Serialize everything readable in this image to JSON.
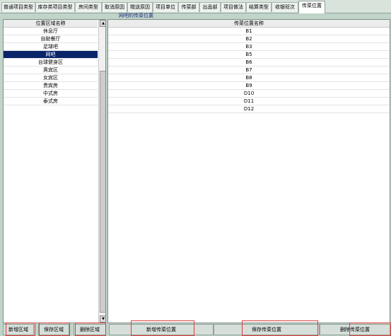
{
  "tabs": [
    {
      "label": "普通项目类型"
    },
    {
      "label": "库存类项目类型"
    },
    {
      "label": "房间类型"
    },
    {
      "label": "取消原因"
    },
    {
      "label": "赠送原因"
    },
    {
      "label": "项目单位"
    },
    {
      "label": "传菜部"
    },
    {
      "label": "出品部"
    },
    {
      "label": "项目做法"
    },
    {
      "label": "结算类型"
    },
    {
      "label": "收银班次"
    },
    {
      "label": "传菜位置"
    }
  ],
  "left_panel": {
    "column_header": "位置区域名称",
    "items": [
      {
        "label": "休息厅"
      },
      {
        "label": "自助餐厅"
      },
      {
        "label": "足球吧"
      },
      {
        "label": "网吧"
      },
      {
        "label": "台球健身区"
      },
      {
        "label": "男宾区"
      },
      {
        "label": "女宾区"
      },
      {
        "label": "贵宾房"
      },
      {
        "label": "中式房"
      },
      {
        "label": "泰式房"
      }
    ],
    "selected_index": 3
  },
  "right_panel": {
    "title": "网吧的传菜位置",
    "column_header": "传菜位置名称",
    "items": [
      {
        "label": "B1"
      },
      {
        "label": "B2"
      },
      {
        "label": "B3"
      },
      {
        "label": "B5"
      },
      {
        "label": "B6"
      },
      {
        "label": "B7"
      },
      {
        "label": "B8"
      },
      {
        "label": "B9"
      },
      {
        "label": "D10"
      },
      {
        "label": "D11"
      },
      {
        "label": "D12"
      }
    ]
  },
  "buttons": {
    "add_area": "新增区域",
    "save_area": "保存区域",
    "delete_area": "删除区域",
    "add_position": "新增传菜位置",
    "save_position": "保存传菜位置",
    "delete_position": "删除传菜位置"
  },
  "colors": {
    "background": "#c0d4c9",
    "selected_row": "#0a246a",
    "highlight_box": "#e23c3c"
  }
}
